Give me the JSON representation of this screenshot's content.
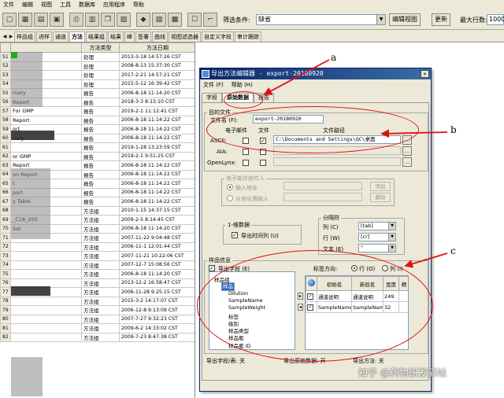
{
  "menubar": [
    "文件",
    "编辑",
    "视图",
    "工具",
    "数据库",
    "应用程序",
    "帮助"
  ],
  "toolbar": {
    "filter_label": "筛选条件:",
    "filter_value": "缺省",
    "edit_view_btn": "编辑视图",
    "refresh_btn": "更新",
    "max_rows_label": "最大行数:",
    "max_rows_value": "1000"
  },
  "tabs": [
    "样品组",
    "进样",
    "通道",
    "方法",
    "结果组",
    "结果",
    "峰",
    "签署",
    "曲线",
    "视图滤选器",
    "自定义字段",
    "审计跟踪"
  ],
  "active_tab": "方法",
  "grid": {
    "columns": [
      "",
      "",
      "方法类型",
      "方法日期"
    ],
    "rows": [
      {
        "rh": "51",
        "name": "",
        "type": "处理",
        "date": "2013-3-18 14:57:26 CST"
      },
      {
        "rh": "52",
        "name": "",
        "type": "处理",
        "date": "2008-8-13 15:37:30 CST"
      },
      {
        "rh": "53",
        "name": "",
        "type": "处理",
        "date": "2017-2-21 14:57:21 CST"
      },
      {
        "rh": "54",
        "name": "",
        "type": "处理",
        "date": "2015-5-12 16:39:42 CST"
      },
      {
        "rh": "55",
        "name": "mary",
        "type": "报告",
        "date": "2006-8-18 11:14:20 CST"
      },
      {
        "rh": "56",
        "name": "Report",
        "type": "报告",
        "date": "2018-3-3 8:13:10 CST"
      },
      {
        "rh": "57",
        "name": "For GMP",
        "type": "报告",
        "date": "2019-2-1 11:12:41 CST"
      },
      {
        "rh": "58",
        "name": "Report",
        "type": "报告",
        "date": "2006-8-18 11:14:22 CST"
      },
      {
        "rh": "59",
        "name": "ort",
        "type": "报告",
        "date": "2006-8-18 11:14:22 CST"
      },
      {
        "rh": "60",
        "name": "nary",
        "type": "报告",
        "date": "2006-8-18 11:14:22 CST"
      },
      {
        "rh": "61",
        "name": "",
        "type": "报告",
        "date": "2019-1-28 13:23:59 CST"
      },
      {
        "rh": "62",
        "name": "or GMP",
        "type": "报告",
        "date": "2019-2-1 9:51:25 CST"
      },
      {
        "rh": "63",
        "name": "Report",
        "type": "报告",
        "date": "2006-8-18 11:14:22 CST"
      },
      {
        "rh": "64",
        "name": "on Report",
        "type": "报告",
        "date": "2006-8-18 11:14:22 CST"
      },
      {
        "rh": "65",
        "name": "t",
        "type": "报告",
        "date": "2006-8-18 11:14:22 CST"
      },
      {
        "rh": "66",
        "name": "port",
        "type": "报告",
        "date": "2006-8-18 11:14:22 CST"
      },
      {
        "rh": "67",
        "name": "y Table",
        "type": "报告",
        "date": "2006-8-18 11:14:22 CST"
      },
      {
        "rh": "68",
        "name": "",
        "type": "方法组",
        "date": "2010-1-15 14:37:15 CST"
      },
      {
        "rh": "69",
        "name": "_C18_250",
        "type": "方法组",
        "date": "2009-2-5 8:14:45 CST"
      },
      {
        "rh": "70",
        "name": "Set",
        "type": "方法组",
        "date": "2006-8-18 11:14:20 CST"
      },
      {
        "rh": "71",
        "name": "",
        "type": "方法组",
        "date": "2007-11-22 9:04:48 CST"
      },
      {
        "rh": "72",
        "name": "",
        "type": "方法组",
        "date": "2006-11-1 12:01:44 CST"
      },
      {
        "rh": "73",
        "name": "",
        "type": "方法组",
        "date": "2007-11-21 10:22:06 CST"
      },
      {
        "rh": "74",
        "name": "",
        "type": "方法组",
        "date": "2007-12-7 15:08:56 CST"
      },
      {
        "rh": "75",
        "name": "",
        "type": "方法组",
        "date": "2006-8-18 11:14:20 CST"
      },
      {
        "rh": "76",
        "name": "",
        "type": "方法组",
        "date": "2013-12-2 16:58:47 CST"
      },
      {
        "rh": "77",
        "name": "",
        "type": "方法组",
        "date": "2006-11-28 9:25:15 CST"
      },
      {
        "rh": "78",
        "name": "",
        "type": "方法组",
        "date": "2015-3-2 14:17:07 CST"
      },
      {
        "rh": "79",
        "name": "",
        "type": "方法组",
        "date": "2006-12-8 9:13:09 CST"
      },
      {
        "rh": "80",
        "name": "",
        "type": "方法组",
        "date": "2007-7-27 9:32:23 CST"
      },
      {
        "rh": "81",
        "name": "",
        "type": "方法组",
        "date": "2009-6-2 14:33:02 CST"
      },
      {
        "rh": "82",
        "name": "",
        "type": "方法组",
        "date": "2009-7-23 8:47:38 CST"
      }
    ]
  },
  "dialog": {
    "title": "导出方法编辑器 - export-20180920",
    "menu": [
      "文件 (F)",
      "帮助 (H)"
    ],
    "tabs": [
      "字段",
      "原始数据",
      "报告"
    ],
    "active_tab": "原始数据",
    "target_file": {
      "group_label": "目的文件",
      "filename_label": "文件名 (F):",
      "filename_value": "export-20180920",
      "email_header": "电子邮件",
      "file_header": "文件",
      "path_header": "文件路径",
      "ascii_label": "ASCII:",
      "ascii_path": "C:\\Documents and Settings\\QC\\桌面",
      "aia_label": "AIA:",
      "openlynx_label": "OpenLynx:"
    },
    "email_receiver": {
      "group_label": "电子邮件收件人",
      "input_address": "输入地址",
      "from_address_book": "从地址簿输入",
      "add_btn": "添加",
      "delete_btn": "删除"
    },
    "one_dim": {
      "group_label": "1-维数据",
      "export_time_col": "导出时间列 (U)"
    },
    "separator": {
      "group_label": "分隔符",
      "col_label": "列 (C)",
      "col_value": "[tab]",
      "row_label": "行 (W)",
      "row_value": "[cr]",
      "text_label": "文本 (E)",
      "text_value": "\""
    },
    "sample_info": {
      "group_label": "样品信息",
      "export_field": "导出字段 (E)",
      "label_direction": "标签方向:",
      "dir_row": "行 (O)",
      "dir_col": "列 (I)",
      "tree": [
        {
          "label": "样品组",
          "depth": 0
        },
        {
          "label": "样品",
          "depth": 1,
          "selected": true
        },
        {
          "label": "Dilution",
          "depth": 2
        },
        {
          "label": "SampleName",
          "depth": 2
        },
        {
          "label": "SampleWeight",
          "depth": 2
        },
        {
          "label": "标签",
          "depth": 2
        },
        {
          "label": "级别",
          "depth": 2
        },
        {
          "label": "样品类型",
          "depth": 2
        },
        {
          "label": "样品瓶",
          "depth": 2
        },
        {
          "label": "样品瓶 ID",
          "depth": 2
        }
      ],
      "fields_columns": [
        "",
        "初始名",
        "新段名",
        "宽度",
        "精"
      ],
      "fields_rows": [
        {
          "checked": true,
          "orig": "通道说明",
          "new": "通道说明",
          "width": "249",
          "prec": ""
        },
        {
          "checked": true,
          "orig": "SampleName",
          "new": "SampleName",
          "width": "32",
          "prec": ""
        }
      ]
    },
    "status": {
      "export_field": "导出字段/表: 关",
      "export_raw": "导出原始数据: 开",
      "export_method": "导出方法: 关"
    }
  },
  "annotations": {
    "a": "a",
    "b": "b",
    "c": "c"
  },
  "watermark": "知乎 @药物研发驿站"
}
